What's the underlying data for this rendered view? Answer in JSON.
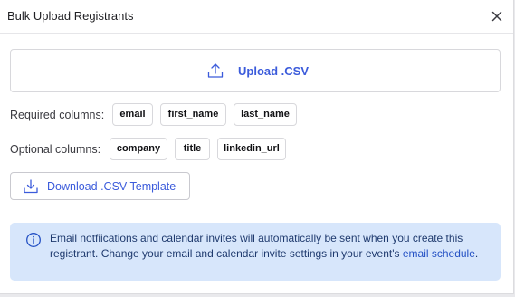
{
  "dialog": {
    "title": "Bulk Upload Registrants"
  },
  "upload": {
    "label": "Upload .CSV"
  },
  "required": {
    "label": "Required columns:",
    "columns": [
      "email",
      "first_name",
      "last_name"
    ]
  },
  "optional": {
    "label": "Optional columns:",
    "columns": [
      "company",
      "title",
      "linkedin_url"
    ]
  },
  "download": {
    "label": "Download .CSV Template"
  },
  "notice": {
    "text_before": "Email notfiications and calendar invites will automatically be sent when you create this registrant. Change your email and calendar invite settings in your event's ",
    "link": "email schedule",
    "text_after": "."
  },
  "icons": {
    "close": "close-icon",
    "upload": "upload-icon",
    "download": "download-icon",
    "info": "info-icon"
  },
  "colors": {
    "accent": "#3b5bdb",
    "notice_bg": "#d7e6fb",
    "notice_text": "#1f3a6e",
    "link": "#2451c4"
  }
}
